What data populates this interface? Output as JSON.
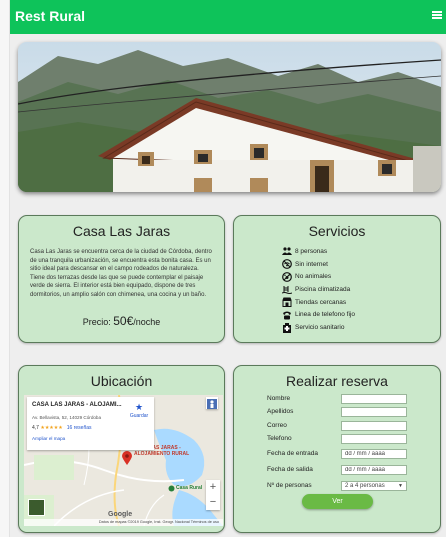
{
  "brand": {
    "name": "Rest Rural"
  },
  "colors": {
    "accent": "#0ec35a",
    "card_bg": "#cbe8cb",
    "button": "#6aba45"
  },
  "description_card": {
    "title": "Casa Las Jaras",
    "text": "Casa Las Jaras se encuentra cerca de la ciudad de Córdoba, dentro de una tranquila urbanización, se encuentra esta bonita casa. Es un sitio ideal para descansar en el campo rodeados de naturaleza. Tiene dos terrazas desde las que se puede contemplar el paisaje verde de sierra. El interior está bien equipado, dispone de tres dormitorios, un amplio salón con chimenea, una cocina y un baño.",
    "price_label": "Precio: ",
    "price_amount": "50€",
    "price_unit": "/noche"
  },
  "services_card": {
    "title": "Servicios",
    "items": [
      {
        "icon": "people-icon",
        "label": "8 personas"
      },
      {
        "icon": "no-wifi-icon",
        "label": "Sin internet"
      },
      {
        "icon": "no-pets-icon",
        "label": "No animales"
      },
      {
        "icon": "pool-icon",
        "label": "Piscina climatizada"
      },
      {
        "icon": "shop-icon",
        "label": "Tiendas cercanas"
      },
      {
        "icon": "phone-icon",
        "label": "Linea de telefono fijo"
      },
      {
        "icon": "hospital-icon",
        "label": "Servicio sanitario"
      }
    ]
  },
  "location_card": {
    "title": "Ubicación",
    "map": {
      "place_name": "CASA LAS JARAS - ALOJAMI...",
      "address": "Av. Bellavista, 52, 14029 Córdoba",
      "rating": "4,7",
      "stars": "★★★★★",
      "reviews": "16 reseñas",
      "link": "Ampliar el mapa",
      "save_label": "Guardar",
      "marker_label_1": "CASA LAS JARAS -",
      "marker_label_2": "ALOJAMIENTO RURAL",
      "secondary_label": "Casa Rural",
      "zoom_in": "+",
      "zoom_out": "−",
      "google": "Google",
      "footer": "Datos de mapas ©2019 Google, Inst. Geogr. Nacional   Términos de uso"
    }
  },
  "booking_card": {
    "title": "Realizar reserva",
    "fields": [
      {
        "label": "Nombre",
        "value": "",
        "placeholder": ""
      },
      {
        "label": "Apellidos",
        "value": "",
        "placeholder": ""
      },
      {
        "label": "Correo",
        "value": "",
        "placeholder": ""
      },
      {
        "label": "Telefono",
        "value": "",
        "placeholder": ""
      },
      {
        "label": "Fecha de entrada",
        "value": "dd / mm / aaaa",
        "placeholder": "dd / mm / aaaa"
      },
      {
        "label": "Fecha de salida",
        "value": "dd / mm / aaaa",
        "placeholder": "dd / mm / aaaa"
      }
    ],
    "persons_label": "Nº de personas",
    "persons_selected": "2 a 4 personas",
    "submit_label": "Ver"
  }
}
